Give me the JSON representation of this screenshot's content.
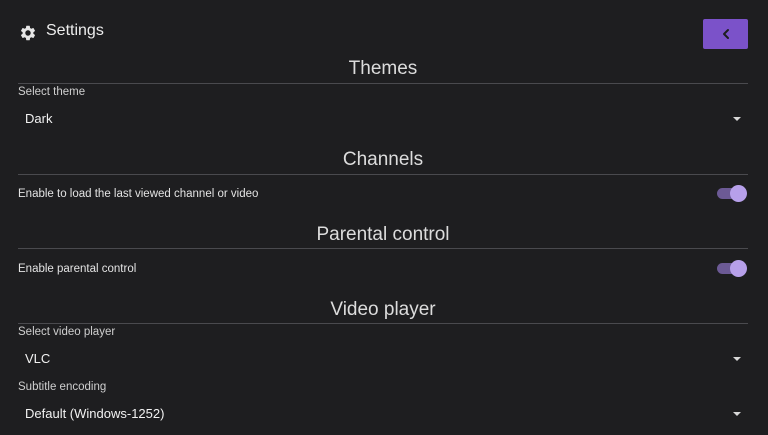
{
  "header": {
    "title": "Settings",
    "icon": "gear-icon",
    "back_icon": "chevron-left-icon"
  },
  "colors": {
    "background": "#1e1e20",
    "accent": "#7b52c9",
    "toggle_track": "#6c5a95",
    "toggle_knob": "#b7a0ea"
  },
  "sections": {
    "themes": {
      "title": "Themes",
      "select_label": "Select theme",
      "select_value": "Dark"
    },
    "channels": {
      "title": "Channels",
      "toggle_label": "Enable to load the last viewed channel or video",
      "toggle_on": true
    },
    "parental": {
      "title": "Parental control",
      "toggle_label": "Enable parental control",
      "toggle_on": true
    },
    "video": {
      "title": "Video player",
      "player_label": "Select video player",
      "player_value": "VLC",
      "subtitle_label": "Subtitle encoding",
      "subtitle_value": "Default (Windows-1252)"
    }
  }
}
